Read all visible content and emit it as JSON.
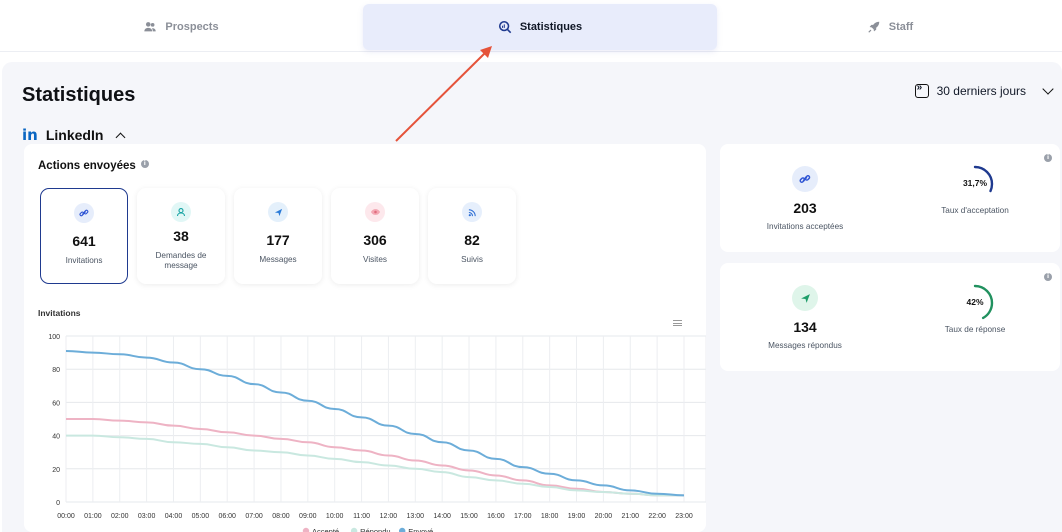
{
  "tabs": [
    {
      "label": "Prospects",
      "icon": "users-icon"
    },
    {
      "label": "Statistiques",
      "icon": "chart-search-icon",
      "active": true
    },
    {
      "label": "Staff",
      "icon": "rocket-icon"
    }
  ],
  "page": {
    "title": "Statistiques",
    "period": "30 derniers jours"
  },
  "section": {
    "logo": "in",
    "title": "LinkedIn"
  },
  "actions": {
    "title": "Actions envoyées",
    "info": "i",
    "tiles": [
      {
        "value": "641",
        "label": "Invitations",
        "icon": "link-icon",
        "color": "#2f55d4",
        "bg": "#e6edfb"
      },
      {
        "value": "38",
        "label": "Demandes de message",
        "icon": "user-message-icon",
        "color": "#16a3a3",
        "bg": "#e1f7f6"
      },
      {
        "value": "177",
        "label": "Messages",
        "icon": "send-icon",
        "color": "#2b7bd8",
        "bg": "#e4f0fb"
      },
      {
        "value": "306",
        "label": "Visites",
        "icon": "eye-icon",
        "color": "#e06b7d",
        "bg": "#fde8ec"
      },
      {
        "value": "82",
        "label": "Suivis",
        "icon": "rss-icon",
        "color": "#2f6fd4",
        "bg": "#e6effc"
      }
    ]
  },
  "chart_data": {
    "type": "line",
    "title": "Invitations",
    "x": [
      "00:00",
      "01:00",
      "02:00",
      "03:00",
      "04:00",
      "05:00",
      "06:00",
      "07:00",
      "08:00",
      "09:00",
      "10:00",
      "11:00",
      "12:00",
      "13:00",
      "14:00",
      "15:00",
      "16:00",
      "17:00",
      "18:00",
      "19:00",
      "20:00",
      "21:00",
      "22:00",
      "23:00"
    ],
    "ylim": [
      0,
      100
    ],
    "yticks": [
      "100",
      "80",
      "60",
      "40",
      "20",
      "0"
    ],
    "series": [
      {
        "name": "Accepté",
        "color": "#eeb3c4",
        "values": [
          50,
          50,
          49,
          48,
          46,
          44,
          42,
          40,
          38,
          36,
          33,
          31,
          28,
          25,
          22,
          19,
          16,
          13,
          10,
          8,
          6,
          5,
          4,
          4
        ]
      },
      {
        "name": "Répondu",
        "color": "#c9e8e0",
        "values": [
          40,
          40,
          39,
          38,
          36,
          35,
          33,
          31,
          30,
          28,
          26,
          24,
          22,
          20,
          18,
          15,
          13,
          11,
          9,
          7,
          6,
          5,
          4,
          4
        ]
      },
      {
        "name": "Envoyé",
        "color": "#6cadd9",
        "values": [
          91,
          90,
          89,
          87,
          84,
          80,
          76,
          71,
          66,
          61,
          56,
          51,
          46,
          41,
          36,
          31,
          26,
          21,
          17,
          13,
          10,
          7,
          5,
          4
        ]
      }
    ],
    "legend": "bottom-center",
    "grid": true
  },
  "kpis": [
    {
      "value": "203",
      "label": "Invitations acceptées",
      "icon": "link-icon",
      "color": "#2f55d4",
      "bg": "#e6edfb",
      "rate": "31,7%",
      "rate_value": 0.317,
      "rate_label": "Taux d'acceptation",
      "ring_color": "#1f3a8f"
    },
    {
      "value": "134",
      "label": "Messages répondus",
      "icon": "send-icon",
      "color": "#1e9e6a",
      "bg": "#dff5ea",
      "rate": "42%",
      "rate_value": 0.42,
      "rate_label": "Taux de réponse",
      "ring_color": "#21915f"
    }
  ]
}
